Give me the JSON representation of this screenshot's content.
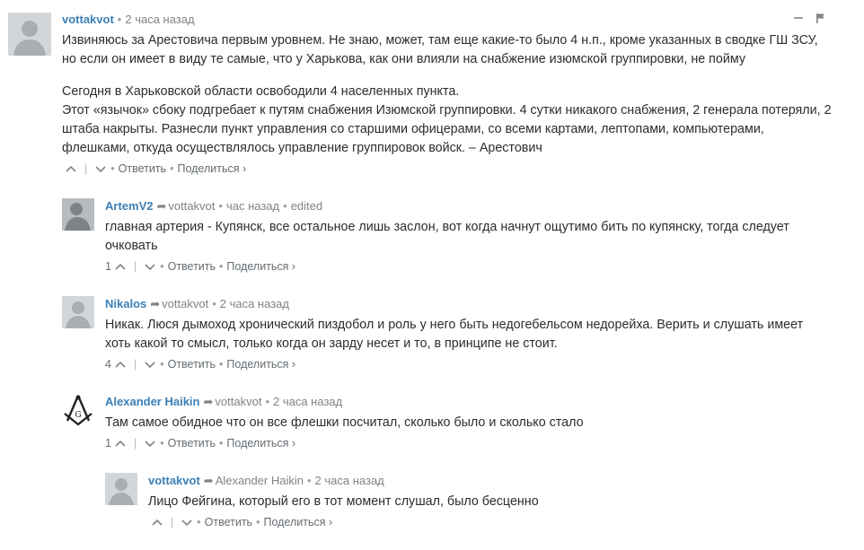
{
  "comments": [
    {
      "author": "vottakvot",
      "time": "2 часа назад",
      "paragraphs": [
        "Извиняюсь за Арестовича первым уровнем. Не знаю, может, там еще какие-то было 4 н.п., кроме указанных в сводке ГШ ЗСУ, но если он имеет в виду те самые, что у Харькова, как они влияли на снабжение изюмской группировки, не пойму",
        "Сегодня в Харьковской области освободили 4 населенных пункта.",
        "Этот «язычок» сбоку подгребает к путям снабжения Изюмской группировки. 4 сутки никакого снабжения, 2 генерала потеряли, 2 штаба накрыты. Разнесли пункт управления со старшими офицерами, со всеми картами, лептопами, компьютерами, флешками, откуда осуществлялось управление группировок войск. – Арестович"
      ],
      "upvotes": "",
      "reply_label": "Ответить",
      "share_label": "Поделиться ›"
    },
    {
      "author": "ArtemV2",
      "reply_to": "vottakvot",
      "time": "час назад",
      "edited": "edited",
      "text": "главная артерия - Купянск, все остальное лишь заслон, вот когда начнут ощутимо бить по купянску, тогда следует очковать",
      "upvotes": "1",
      "reply_label": "Ответить",
      "share_label": "Поделиться ›"
    },
    {
      "author": "Nikalos",
      "reply_to": "vottakvot",
      "time": "2 часа назад",
      "text": "Никак. Люся дымоход хронический пиздобол и роль у него быть недогебельсом недорейха. Верить и слушать имеет хоть какой то смысл, только когда он зарду несет и то, в принципе не стоит.",
      "upvotes": "4",
      "reply_label": "Ответить",
      "share_label": "Поделиться ›"
    },
    {
      "author": "Alexander Haikin",
      "reply_to": "vottakvot",
      "time": "2 часа назад",
      "text": "Там самое обидное что он все флешки посчитал, сколько было и сколько стало",
      "upvotes": "1",
      "reply_label": "Ответить",
      "share_label": "Поделиться ›"
    },
    {
      "author": "vottakvot",
      "reply_to": "Alexander Haikin",
      "time": "2 часа назад",
      "text": "Лицо Фейгина, который его в тот момент слушал, было бесценно",
      "upvotes": "",
      "reply_label": "Ответить",
      "share_label": "Поделиться ›"
    }
  ],
  "colors": {
    "author": "#3b7fb5",
    "meta": "#7e8487",
    "text": "#2a2e2e",
    "avatar": "#c9cdd1"
  },
  "icons": [
    "collapse-icon",
    "flag-icon",
    "upvote-chevron-icon",
    "downvote-chevron-icon",
    "reply-arrow-icon",
    "default-avatar-icon",
    "compass-square-avatar-icon"
  ]
}
